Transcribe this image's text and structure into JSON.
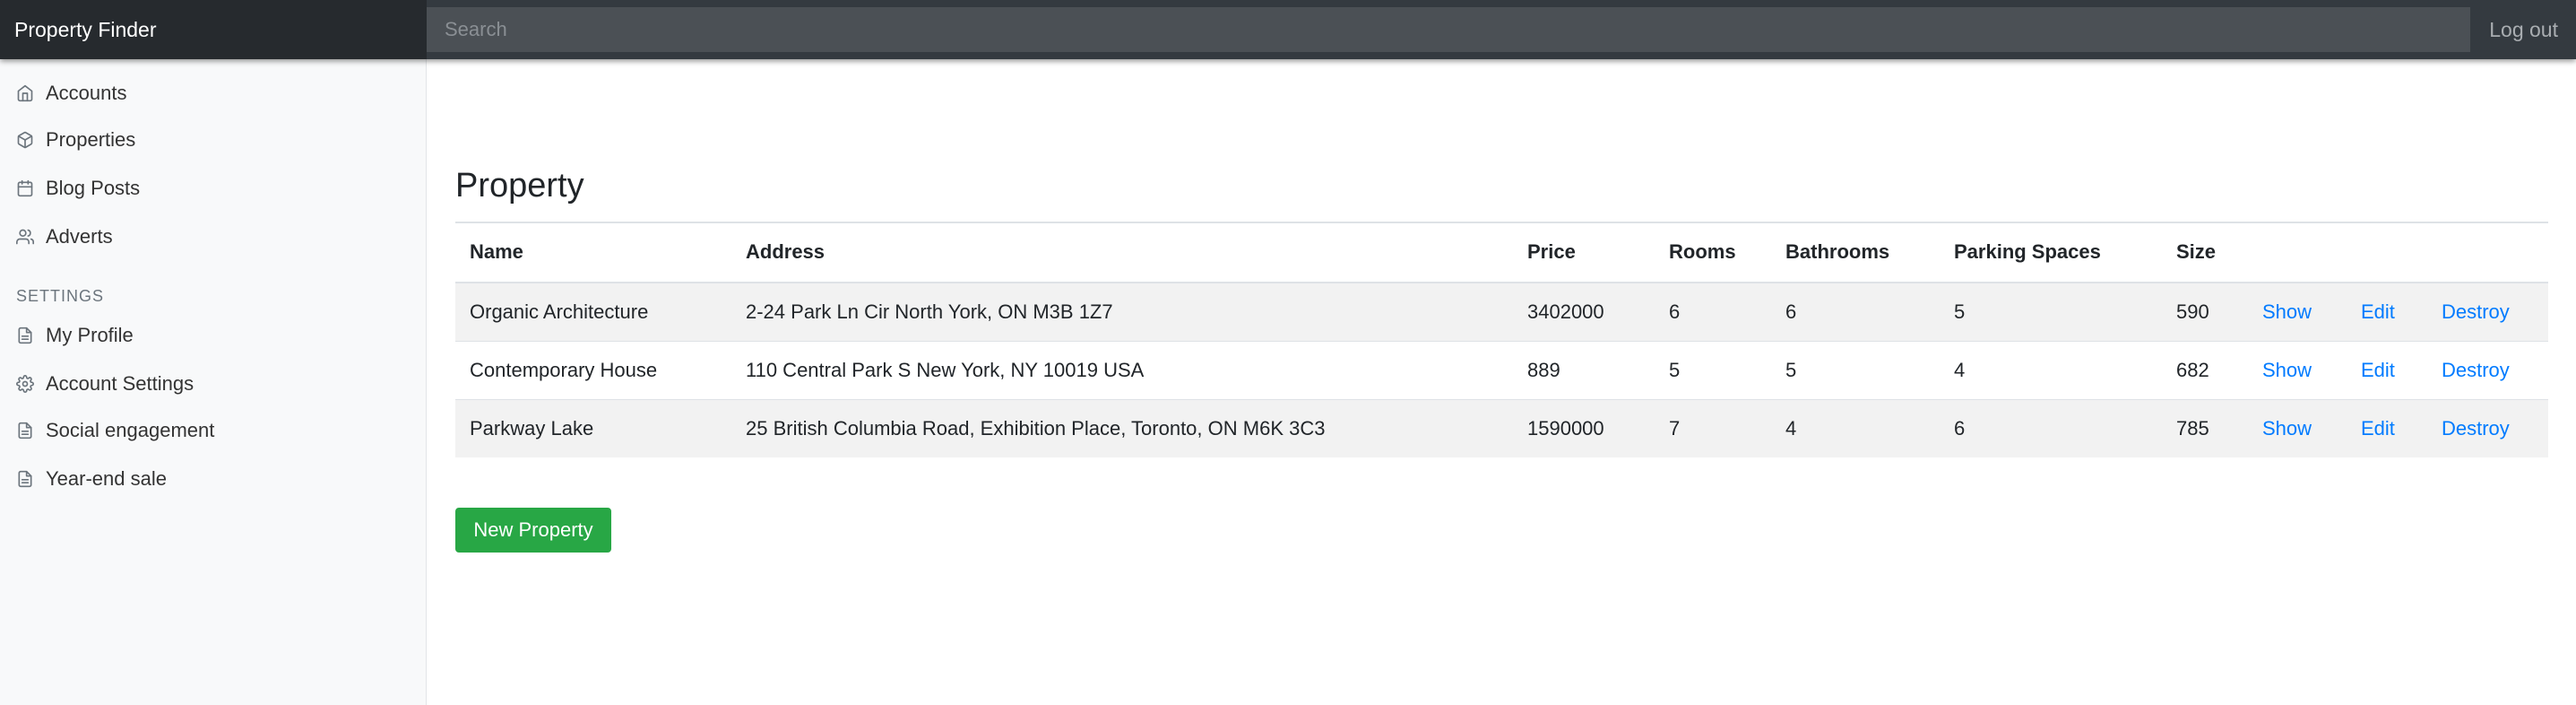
{
  "navbar": {
    "brand": "Property Finder",
    "search_placeholder": "Search",
    "logout_label": "Log out"
  },
  "sidebar": {
    "items": [
      {
        "label": "Accounts",
        "icon": "home-icon"
      },
      {
        "label": "Properties",
        "icon": "box-icon"
      },
      {
        "label": "Blog Posts",
        "icon": "calendar-icon"
      },
      {
        "label": "Adverts",
        "icon": "users-icon"
      }
    ],
    "settings_heading": "SETTINGS",
    "settings_items": [
      {
        "label": "My Profile",
        "icon": "file-icon"
      },
      {
        "label": "Account Settings",
        "icon": "gear-icon"
      },
      {
        "label": "Social engagement",
        "icon": "file-icon"
      },
      {
        "label": "Year-end sale",
        "icon": "file-icon"
      }
    ]
  },
  "main": {
    "title": "Property",
    "columns": [
      "Name",
      "Address",
      "Price",
      "Rooms",
      "Bathrooms",
      "Parking Spaces",
      "Size"
    ],
    "rows": [
      {
        "name": "Organic Architecture",
        "address": "2-24 Park Ln Cir North York, ON M3B 1Z7",
        "price": "3402000",
        "rooms": "6",
        "bathrooms": "6",
        "parking": "5",
        "size": "590"
      },
      {
        "name": "Contemporary House",
        "address": "110 Central Park S New York, NY 10019 USA",
        "price": "889",
        "rooms": "5",
        "bathrooms": "5",
        "parking": "4",
        "size": "682"
      },
      {
        "name": "Parkway Lake",
        "address": "25 British Columbia Road, Exhibition Place, Toronto, ON M6K 3C3",
        "price": "1590000",
        "rooms": "7",
        "bathrooms": "4",
        "parking": "6",
        "size": "785"
      }
    ],
    "actions": {
      "show": "Show",
      "edit": "Edit",
      "destroy": "Destroy"
    },
    "new_button": "New Property"
  },
  "colors": {
    "navbar": "#343a40",
    "brand_bg": "#262a2e",
    "link": "#007bff",
    "button_success": "#28a745",
    "sidebar_bg": "#f8f9fa"
  }
}
